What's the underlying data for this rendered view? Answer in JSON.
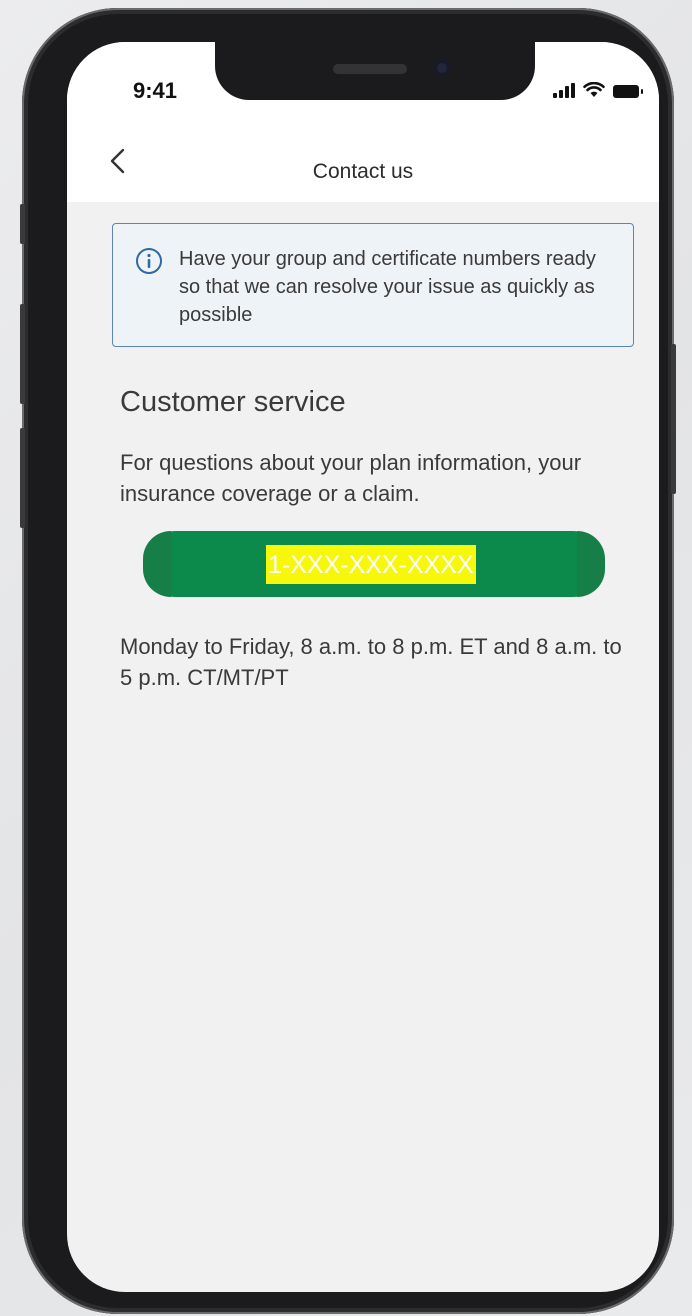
{
  "status_bar": {
    "time": "9:41"
  },
  "nav": {
    "title": "Contact us",
    "back_icon": "chevron-left-icon"
  },
  "info_banner": {
    "icon": "info-circle-icon",
    "text": "Have your group and certificate numbers ready so that we can resolve your issue as quickly as possible",
    "colors": {
      "background": "#eef3f7",
      "border": "#5b86b4"
    }
  },
  "customer_service": {
    "heading": "Customer service",
    "description": "For questions about your plan information, your insurance coverage or a claim.",
    "call_button": {
      "label": "1-XXX-XXX-XXXX",
      "color": "#0b8a4c",
      "highlight": "#f7f70a"
    },
    "hours": "Monday to Friday, 8 a.m. to 8 p.m. ET and 8 a.m. to 5 p.m. CT/MT/PT"
  }
}
